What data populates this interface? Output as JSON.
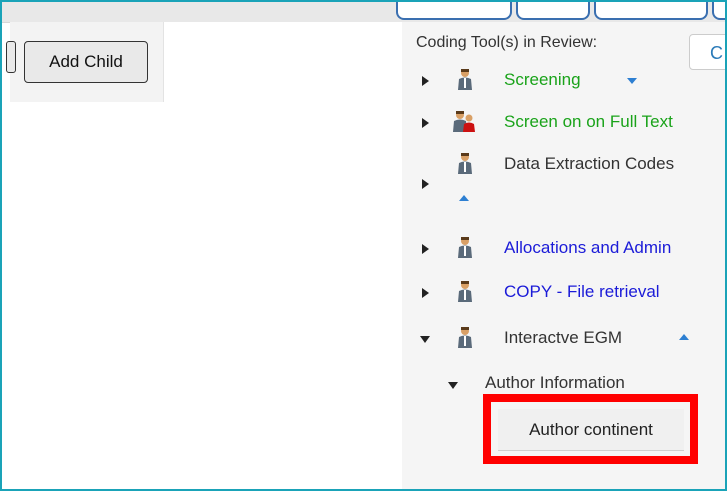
{
  "toolbar": {
    "add_child_label": "Add Child"
  },
  "review": {
    "label": "Coding Tool(s) in Review:",
    "select_value": "C"
  },
  "coding_tools": [
    {
      "label": "Screening",
      "color": "#1aa31a",
      "icon": "person-icon",
      "caret": "down"
    },
    {
      "label": "Screen on on Full Text",
      "color": "#1aa31a",
      "icon": "person-red-icon",
      "caret": "none"
    },
    {
      "label": "Data Extraction Codes",
      "color": "#333333",
      "icon": "person-icon",
      "caret": "up"
    },
    {
      "label": "Allocations and Admin",
      "color": "#1b1bd8",
      "icon": "person-icon",
      "caret": "none"
    },
    {
      "label": "COPY - File retrieval",
      "color": "#1b1bd8",
      "icon": "person-icon",
      "caret": "none"
    },
    {
      "label": "Interactve EGM",
      "color": "#333333",
      "icon": "person-icon",
      "caret": "up",
      "expanded": true
    }
  ],
  "sub_items": {
    "author_information": "Author Information",
    "author_continent": "Author continent"
  },
  "colors": {
    "highlight": "#ff0000",
    "frame": "#1aa3b8",
    "caret": "#2d7fd2"
  }
}
